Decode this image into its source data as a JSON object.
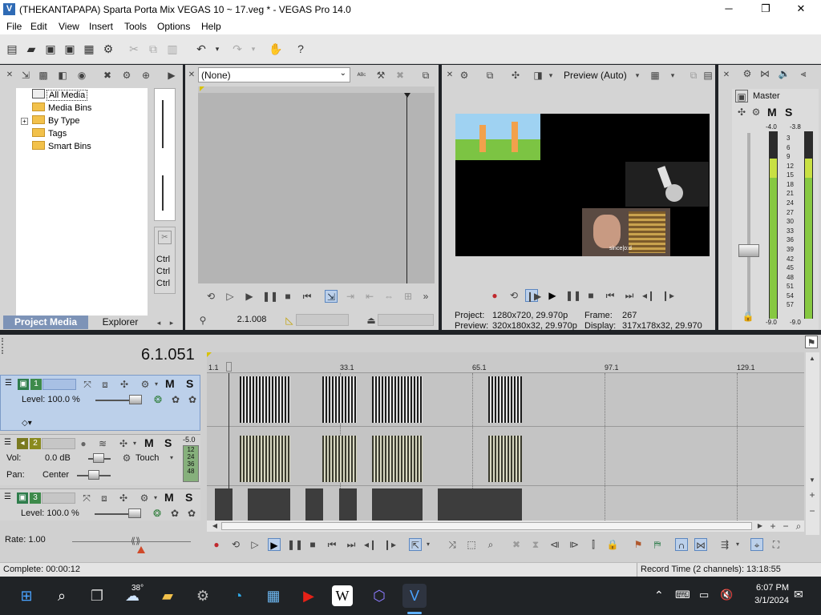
{
  "window": {
    "title": "(THEKANTAPAPA) Sparta Porta Mix VEGAS 10 ~ 17.veg * - VEGAS Pro 14.0",
    "controls": [
      "─",
      "❐",
      "✕"
    ]
  },
  "menu": [
    "File",
    "Edit",
    "View",
    "Insert",
    "Tools",
    "Options",
    "Help"
  ],
  "project_media": {
    "tree": [
      {
        "label": "All Media",
        "selected": true
      },
      {
        "label": "Media Bins"
      },
      {
        "label": "By Type",
        "expander": "+"
      },
      {
        "label": "Tags"
      },
      {
        "label": "Smart Bins"
      }
    ],
    "ctrl_labels": [
      "Ctrl",
      "Ctrl",
      "Ctrl"
    ],
    "tabs": [
      "Project Media",
      "Explorer"
    ]
  },
  "trimmer": {
    "dropdown_value": "(None)",
    "timecode": "2.1.008"
  },
  "preview": {
    "mode": "Preview (Auto)",
    "video_caption": "since|o:d",
    "info": {
      "project_label": "Project:",
      "project_value": "1280x720, 29.970p",
      "preview_label": "Preview:",
      "preview_value": "320x180x32, 29.970p",
      "frame_label": "Frame:",
      "frame_value": "267",
      "display_label": "Display:",
      "display_value": "317x178x32, 29.970"
    }
  },
  "master": {
    "title": "Master",
    "m": "M",
    "s": "S",
    "top_left": "-4.0",
    "top_right": "-3.8",
    "bottom_left": "-9.0",
    "bottom_right": "-9.0",
    "scale": [
      "3",
      "6",
      "9",
      "12",
      "15",
      "18",
      "21",
      "24",
      "27",
      "30",
      "33",
      "36",
      "39",
      "42",
      "45",
      "48",
      "51",
      "54",
      "57"
    ],
    "level_left": 0.87,
    "level_right": 0.87
  },
  "timeline": {
    "timecode": "6.1.051",
    "ruler": [
      "1.1",
      "33.1",
      "65.1",
      "97.1",
      "129.1"
    ],
    "tracks": [
      {
        "num": "1",
        "type": "video",
        "level_label": "Level: 100.0 %",
        "m": "M",
        "s": "S"
      },
      {
        "num": "2",
        "type": "audio",
        "vol_label": "Vol:",
        "vol_value": "0.0 dB",
        "pan_label": "Pan:",
        "pan_value": "Center",
        "automation": "Touch",
        "m": "M",
        "s": "S",
        "meter_top": "-5.0",
        "meter_scale": [
          "12",
          "24",
          "36",
          "48"
        ]
      },
      {
        "num": "3",
        "type": "video",
        "level_label": "Level: 100.0 %",
        "m": "M",
        "s": "S"
      }
    ]
  },
  "transport": {
    "rate": "Rate: 1.00"
  },
  "status": {
    "complete": "Complete: 00:00:12",
    "record_time": "Record Time (2 channels): 13:18:55"
  },
  "taskbar": {
    "weather": "38°",
    "time": "6:07 PM",
    "date": "3/1/2024"
  },
  "colors": {
    "track_video": "#3d8a4a",
    "track_audio": "#8a8a1f",
    "track_selected": "#bcd0ea",
    "vu_green": "#86c841"
  }
}
